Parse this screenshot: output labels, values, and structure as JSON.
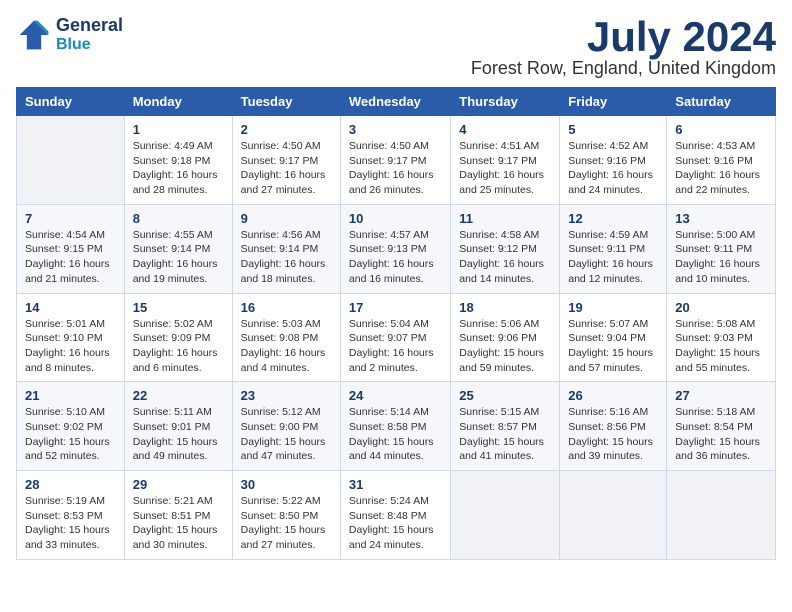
{
  "logo": {
    "line1": "General",
    "line2": "Blue"
  },
  "title": "July 2024",
  "location": "Forest Row, England, United Kingdom",
  "days_of_week": [
    "Sunday",
    "Monday",
    "Tuesday",
    "Wednesday",
    "Thursday",
    "Friday",
    "Saturday"
  ],
  "weeks": [
    [
      {
        "day": "",
        "empty": true
      },
      {
        "day": "1",
        "sunrise": "Sunrise: 4:49 AM",
        "sunset": "Sunset: 9:18 PM",
        "daylight": "Daylight: 16 hours and 28 minutes."
      },
      {
        "day": "2",
        "sunrise": "Sunrise: 4:50 AM",
        "sunset": "Sunset: 9:17 PM",
        "daylight": "Daylight: 16 hours and 27 minutes."
      },
      {
        "day": "3",
        "sunrise": "Sunrise: 4:50 AM",
        "sunset": "Sunset: 9:17 PM",
        "daylight": "Daylight: 16 hours and 26 minutes."
      },
      {
        "day": "4",
        "sunrise": "Sunrise: 4:51 AM",
        "sunset": "Sunset: 9:17 PM",
        "daylight": "Daylight: 16 hours and 25 minutes."
      },
      {
        "day": "5",
        "sunrise": "Sunrise: 4:52 AM",
        "sunset": "Sunset: 9:16 PM",
        "daylight": "Daylight: 16 hours and 24 minutes."
      },
      {
        "day": "6",
        "sunrise": "Sunrise: 4:53 AM",
        "sunset": "Sunset: 9:16 PM",
        "daylight": "Daylight: 16 hours and 22 minutes."
      }
    ],
    [
      {
        "day": "7",
        "sunrise": "Sunrise: 4:54 AM",
        "sunset": "Sunset: 9:15 PM",
        "daylight": "Daylight: 16 hours and 21 minutes."
      },
      {
        "day": "8",
        "sunrise": "Sunrise: 4:55 AM",
        "sunset": "Sunset: 9:14 PM",
        "daylight": "Daylight: 16 hours and 19 minutes."
      },
      {
        "day": "9",
        "sunrise": "Sunrise: 4:56 AM",
        "sunset": "Sunset: 9:14 PM",
        "daylight": "Daylight: 16 hours and 18 minutes."
      },
      {
        "day": "10",
        "sunrise": "Sunrise: 4:57 AM",
        "sunset": "Sunset: 9:13 PM",
        "daylight": "Daylight: 16 hours and 16 minutes."
      },
      {
        "day": "11",
        "sunrise": "Sunrise: 4:58 AM",
        "sunset": "Sunset: 9:12 PM",
        "daylight": "Daylight: 16 hours and 14 minutes."
      },
      {
        "day": "12",
        "sunrise": "Sunrise: 4:59 AM",
        "sunset": "Sunset: 9:11 PM",
        "daylight": "Daylight: 16 hours and 12 minutes."
      },
      {
        "day": "13",
        "sunrise": "Sunrise: 5:00 AM",
        "sunset": "Sunset: 9:11 PM",
        "daylight": "Daylight: 16 hours and 10 minutes."
      }
    ],
    [
      {
        "day": "14",
        "sunrise": "Sunrise: 5:01 AM",
        "sunset": "Sunset: 9:10 PM",
        "daylight": "Daylight: 16 hours and 8 minutes."
      },
      {
        "day": "15",
        "sunrise": "Sunrise: 5:02 AM",
        "sunset": "Sunset: 9:09 PM",
        "daylight": "Daylight: 16 hours and 6 minutes."
      },
      {
        "day": "16",
        "sunrise": "Sunrise: 5:03 AM",
        "sunset": "Sunset: 9:08 PM",
        "daylight": "Daylight: 16 hours and 4 minutes."
      },
      {
        "day": "17",
        "sunrise": "Sunrise: 5:04 AM",
        "sunset": "Sunset: 9:07 PM",
        "daylight": "Daylight: 16 hours and 2 minutes."
      },
      {
        "day": "18",
        "sunrise": "Sunrise: 5:06 AM",
        "sunset": "Sunset: 9:06 PM",
        "daylight": "Daylight: 15 hours and 59 minutes."
      },
      {
        "day": "19",
        "sunrise": "Sunrise: 5:07 AM",
        "sunset": "Sunset: 9:04 PM",
        "daylight": "Daylight: 15 hours and 57 minutes."
      },
      {
        "day": "20",
        "sunrise": "Sunrise: 5:08 AM",
        "sunset": "Sunset: 9:03 PM",
        "daylight": "Daylight: 15 hours and 55 minutes."
      }
    ],
    [
      {
        "day": "21",
        "sunrise": "Sunrise: 5:10 AM",
        "sunset": "Sunset: 9:02 PM",
        "daylight": "Daylight: 15 hours and 52 minutes."
      },
      {
        "day": "22",
        "sunrise": "Sunrise: 5:11 AM",
        "sunset": "Sunset: 9:01 PM",
        "daylight": "Daylight: 15 hours and 49 minutes."
      },
      {
        "day": "23",
        "sunrise": "Sunrise: 5:12 AM",
        "sunset": "Sunset: 9:00 PM",
        "daylight": "Daylight: 15 hours and 47 minutes."
      },
      {
        "day": "24",
        "sunrise": "Sunrise: 5:14 AM",
        "sunset": "Sunset: 8:58 PM",
        "daylight": "Daylight: 15 hours and 44 minutes."
      },
      {
        "day": "25",
        "sunrise": "Sunrise: 5:15 AM",
        "sunset": "Sunset: 8:57 PM",
        "daylight": "Daylight: 15 hours and 41 minutes."
      },
      {
        "day": "26",
        "sunrise": "Sunrise: 5:16 AM",
        "sunset": "Sunset: 8:56 PM",
        "daylight": "Daylight: 15 hours and 39 minutes."
      },
      {
        "day": "27",
        "sunrise": "Sunrise: 5:18 AM",
        "sunset": "Sunset: 8:54 PM",
        "daylight": "Daylight: 15 hours and 36 minutes."
      }
    ],
    [
      {
        "day": "28",
        "sunrise": "Sunrise: 5:19 AM",
        "sunset": "Sunset: 8:53 PM",
        "daylight": "Daylight: 15 hours and 33 minutes."
      },
      {
        "day": "29",
        "sunrise": "Sunrise: 5:21 AM",
        "sunset": "Sunset: 8:51 PM",
        "daylight": "Daylight: 15 hours and 30 minutes."
      },
      {
        "day": "30",
        "sunrise": "Sunrise: 5:22 AM",
        "sunset": "Sunset: 8:50 PM",
        "daylight": "Daylight: 15 hours and 27 minutes."
      },
      {
        "day": "31",
        "sunrise": "Sunrise: 5:24 AM",
        "sunset": "Sunset: 8:48 PM",
        "daylight": "Daylight: 15 hours and 24 minutes."
      },
      {
        "day": "",
        "empty": true
      },
      {
        "day": "",
        "empty": true
      },
      {
        "day": "",
        "empty": true
      }
    ]
  ]
}
